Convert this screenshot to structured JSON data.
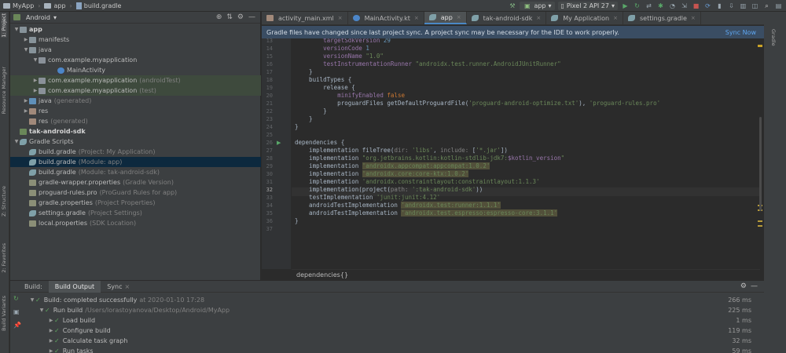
{
  "topbar": {
    "crumbs": [
      "MyApp",
      "app",
      "build.gradle"
    ],
    "run_config": "app",
    "device": "Pixel 2 API 27"
  },
  "left_strip": {
    "tabs": [
      "1: Project",
      "Resource Manager",
      "Z: Structure",
      "2: Favorites",
      "Build Variants"
    ]
  },
  "project": {
    "view_selector": "Android",
    "rows": [
      {
        "label": "app",
        "hint": "",
        "icon": "folder",
        "indent": 0,
        "arrow": "down",
        "bold": true
      },
      {
        "label": "manifests",
        "hint": "",
        "icon": "folder",
        "indent": 1,
        "arrow": "right"
      },
      {
        "label": "java",
        "hint": "",
        "icon": "folder",
        "indent": 1,
        "arrow": "down"
      },
      {
        "label": "com.example.myapplication",
        "hint": "",
        "icon": "pkg",
        "indent": 2,
        "arrow": "down"
      },
      {
        "label": "MainActivity",
        "hint": "",
        "icon": "kt",
        "indent": 4,
        "arrow": ""
      },
      {
        "label": "com.example.myapplication",
        "hint": "(androidTest)",
        "icon": "pkg",
        "indent": 2,
        "arrow": "right",
        "hl": true
      },
      {
        "label": "com.example.myapplication",
        "hint": "(test)",
        "icon": "pkg",
        "indent": 2,
        "arrow": "right",
        "hl": true
      },
      {
        "label": "java",
        "hint": "(generated)",
        "icon": "java",
        "indent": 1,
        "arrow": "right"
      },
      {
        "label": "res",
        "hint": "",
        "icon": "res",
        "indent": 1,
        "arrow": "right"
      },
      {
        "label": "res",
        "hint": "(generated)",
        "icon": "res",
        "indent": 1,
        "arrow": ""
      },
      {
        "label": "tak-android-sdk",
        "hint": "",
        "icon": "mod",
        "indent": 0,
        "arrow": "",
        "bold": true
      },
      {
        "label": "Gradle Scripts",
        "hint": "",
        "icon": "gradle",
        "indent": 0,
        "arrow": "down"
      },
      {
        "label": "build.gradle",
        "hint": "(Project: My Application)",
        "icon": "gradle",
        "indent": 1,
        "arrow": ""
      },
      {
        "label": "build.gradle",
        "hint": "(Module: app)",
        "icon": "gradle",
        "indent": 1,
        "arrow": "",
        "selected": true
      },
      {
        "label": "build.gradle",
        "hint": "(Module: tak-android-sdk)",
        "icon": "gradle",
        "indent": 1,
        "arrow": ""
      },
      {
        "label": "gradle-wrapper.properties",
        "hint": "(Gradle Version)",
        "icon": "props",
        "indent": 1,
        "arrow": ""
      },
      {
        "label": "proguard-rules.pro",
        "hint": "(ProGuard Rules for app)",
        "icon": "props",
        "indent": 1,
        "arrow": ""
      },
      {
        "label": "gradle.properties",
        "hint": "(Project Properties)",
        "icon": "props",
        "indent": 1,
        "arrow": ""
      },
      {
        "label": "settings.gradle",
        "hint": "(Project Settings)",
        "icon": "gradle",
        "indent": 1,
        "arrow": ""
      },
      {
        "label": "local.properties",
        "hint": "(SDK Location)",
        "icon": "props",
        "indent": 1,
        "arrow": ""
      }
    ]
  },
  "editor": {
    "tabs": [
      {
        "label": "activity_main.xml",
        "active": false
      },
      {
        "label": "MainActivity.kt",
        "active": false
      },
      {
        "label": "app",
        "active": true
      },
      {
        "label": "tak-android-sdk",
        "active": false
      },
      {
        "label": "My Application",
        "active": false
      },
      {
        "label": "settings.gradle",
        "active": false
      }
    ],
    "banner": "Gradle files have changed since last project sync. A project sync may be necessary for the IDE to work properly.",
    "banner_action": "Sync Now",
    "line_numbers": [
      "13",
      "14",
      "15",
      "16",
      "17",
      "18",
      "19",
      "20",
      "21",
      "22",
      "23",
      "24",
      "25",
      "26",
      "27",
      "28",
      "29",
      "30",
      "31",
      "32",
      "33",
      "34",
      "35",
      "36",
      "37"
    ],
    "current_line": "32",
    "breadcrumb": "dependencies{}"
  },
  "build": {
    "label": "Build:",
    "tabs": [
      "Build Output",
      "Sync"
    ],
    "rows": [
      {
        "text": "Build: completed successfully",
        "suffix": "at 2020-01-10 17:28",
        "time": "266 ms",
        "indent": 0
      },
      {
        "text": "Run build",
        "suffix": "/Users/lorastoyanova/Desktop/Android/MyApp",
        "time": "225 ms",
        "indent": 1
      },
      {
        "text": "Load build",
        "suffix": "",
        "time": "1 ms",
        "indent": 2
      },
      {
        "text": "Configure build",
        "suffix": "",
        "time": "119 ms",
        "indent": 2
      },
      {
        "text": "Calculate task graph",
        "suffix": "",
        "time": "32 ms",
        "indent": 2
      },
      {
        "text": "Run tasks",
        "suffix": "",
        "time": "59 ms",
        "indent": 2
      }
    ]
  },
  "colors": {
    "accent": "#4a88c7",
    "success": "#5ea35e",
    "banner_bg": "#3a4d63"
  }
}
